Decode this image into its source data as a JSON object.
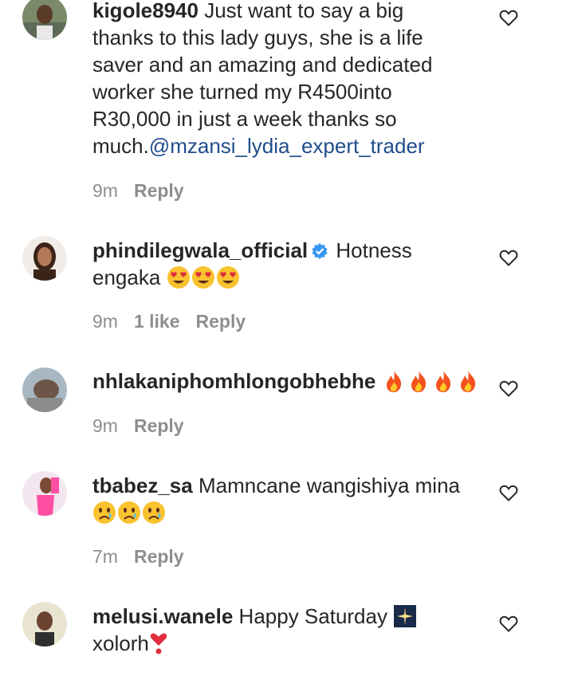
{
  "comments": [
    {
      "username": "kigole8940",
      "text": " Just want to say a big thanks to this lady guys, she is a life saver and an amazing and dedicated worker she turned my R4500into R30,000 in just a week thanks so much.",
      "mention": "@mzansi_lydia_expert_trader",
      "time": "9m",
      "reply": "Reply"
    },
    {
      "username": "phindilegwala_official",
      "verified": true,
      "text": " Hotness engaka ",
      "emojis": [
        "heart-eyes-emoji",
        "heart-eyes-emoji",
        "heart-eyes-emoji"
      ],
      "time": "9m",
      "likes": "1 like",
      "reply": "Reply"
    },
    {
      "username": "nhlakaniphomhlongobhebhe",
      "text": " ",
      "emojis": [
        "fire-emoji",
        "fire-emoji",
        "fire-emoji",
        "fire-emoji"
      ],
      "time": "9m",
      "reply": "Reply"
    },
    {
      "username": "tbabez_sa",
      "text": " Mamncane wangishiya mina ",
      "emojis": [
        "crying-face-emoji",
        "crying-face-emoji",
        "crying-face-emoji"
      ],
      "time": "7m",
      "reply": "Reply"
    },
    {
      "username": "melusi.wanele",
      "text": " Happy Saturday ",
      "text2": "xolorh",
      "emojis": [
        "sparkler-emoji",
        "heart-exclamation-emoji"
      ],
      "time": "",
      "reply": ""
    }
  ],
  "colors": {
    "text": "#262626",
    "meta": "#8e8e8e",
    "mention": "#1f4e8c",
    "verified": "#3897f0"
  }
}
